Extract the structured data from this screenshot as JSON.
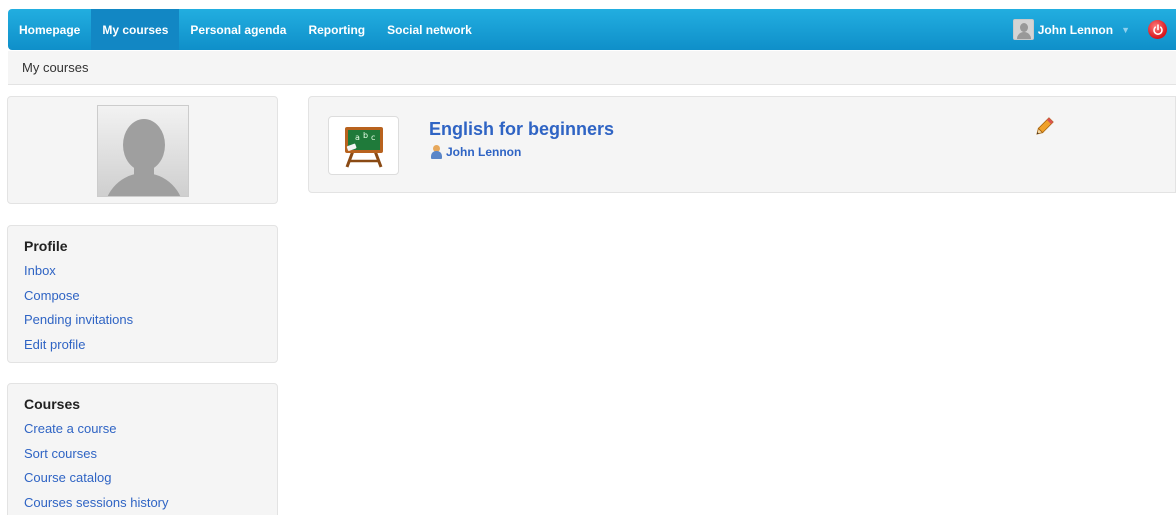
{
  "navbar": {
    "items": [
      {
        "label": "Homepage",
        "active": false
      },
      {
        "label": "My courses",
        "active": true
      },
      {
        "label": "Personal agenda",
        "active": false
      },
      {
        "label": "Reporting",
        "active": false
      },
      {
        "label": "Social network",
        "active": false
      }
    ],
    "user_name": "John Lennon",
    "user_icon": "user-avatar-icon",
    "logout_icon": "power-icon",
    "colors": {
      "bar": "#1aa0d8",
      "active": "#1287c4"
    }
  },
  "breadcrumb": {
    "current": "My courses"
  },
  "sidebar": {
    "profile": {
      "title": "Profile",
      "links": [
        "Inbox",
        "Compose",
        "Pending invitations",
        "Edit profile"
      ]
    },
    "courses": {
      "title": "Courses",
      "links": [
        "Create a course",
        "Sort courses",
        "Course catalog",
        "Courses sessions history"
      ]
    }
  },
  "courses": [
    {
      "title": "English for beginners",
      "teacher": "John Lennon",
      "thumb_icon": "chalkboard-icon",
      "edit_icon": "pencil-icon"
    }
  ],
  "colors": {
    "link": "#2f64c4",
    "panel": "#f5f5f5"
  }
}
